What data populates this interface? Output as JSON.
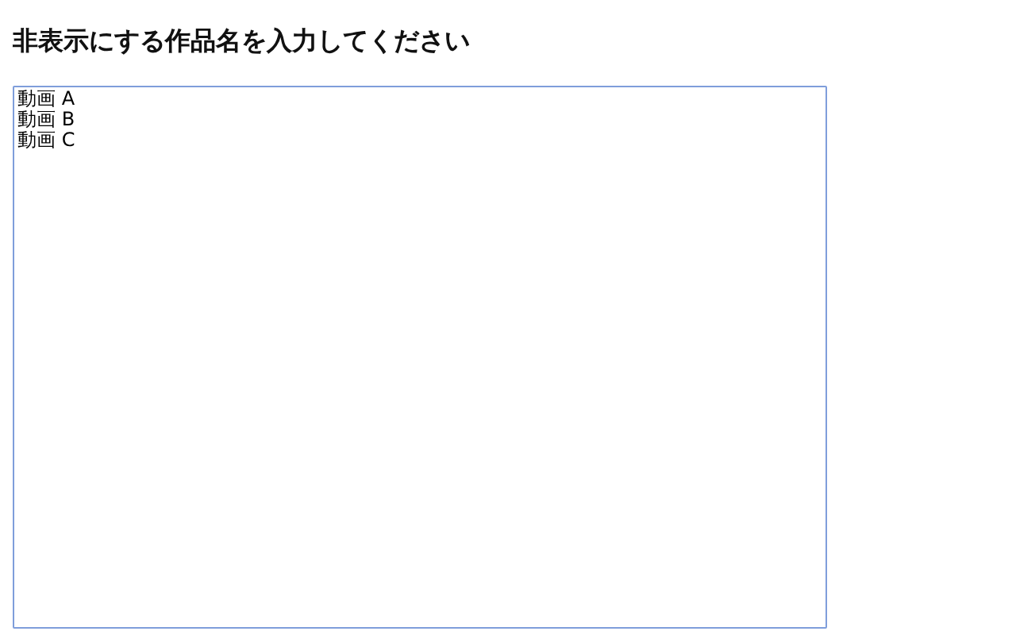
{
  "heading": "非表示にする作品名を入力してください",
  "input": {
    "lines": [
      "動画 A",
      "動画 B",
      "動画 C"
    ]
  }
}
